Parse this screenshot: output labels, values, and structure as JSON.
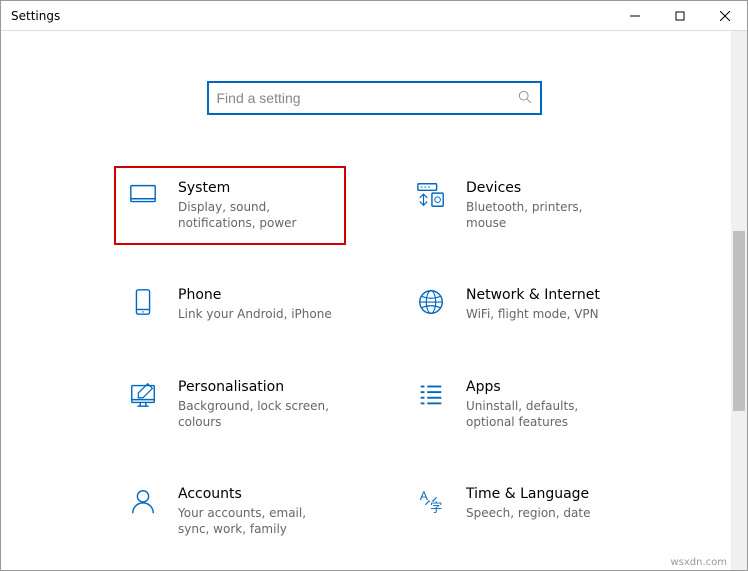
{
  "window": {
    "title": "Settings"
  },
  "search": {
    "placeholder": "Find a setting"
  },
  "categories": [
    {
      "id": "system",
      "title": "System",
      "desc": "Display, sound, notifications, power",
      "highlight": true
    },
    {
      "id": "devices",
      "title": "Devices",
      "desc": "Bluetooth, printers, mouse",
      "highlight": false
    },
    {
      "id": "phone",
      "title": "Phone",
      "desc": "Link your Android, iPhone",
      "highlight": false
    },
    {
      "id": "network",
      "title": "Network & Internet",
      "desc": "WiFi, flight mode, VPN",
      "highlight": false
    },
    {
      "id": "personalisation",
      "title": "Personalisation",
      "desc": "Background, lock screen, colours",
      "highlight": false
    },
    {
      "id": "apps",
      "title": "Apps",
      "desc": "Uninstall, defaults, optional features",
      "highlight": false
    },
    {
      "id": "accounts",
      "title": "Accounts",
      "desc": "Your accounts, email, sync, work, family",
      "highlight": false
    },
    {
      "id": "time-language",
      "title": "Time & Language",
      "desc": "Speech, region, date",
      "highlight": false
    }
  ],
  "watermark": "wsxdn.com"
}
